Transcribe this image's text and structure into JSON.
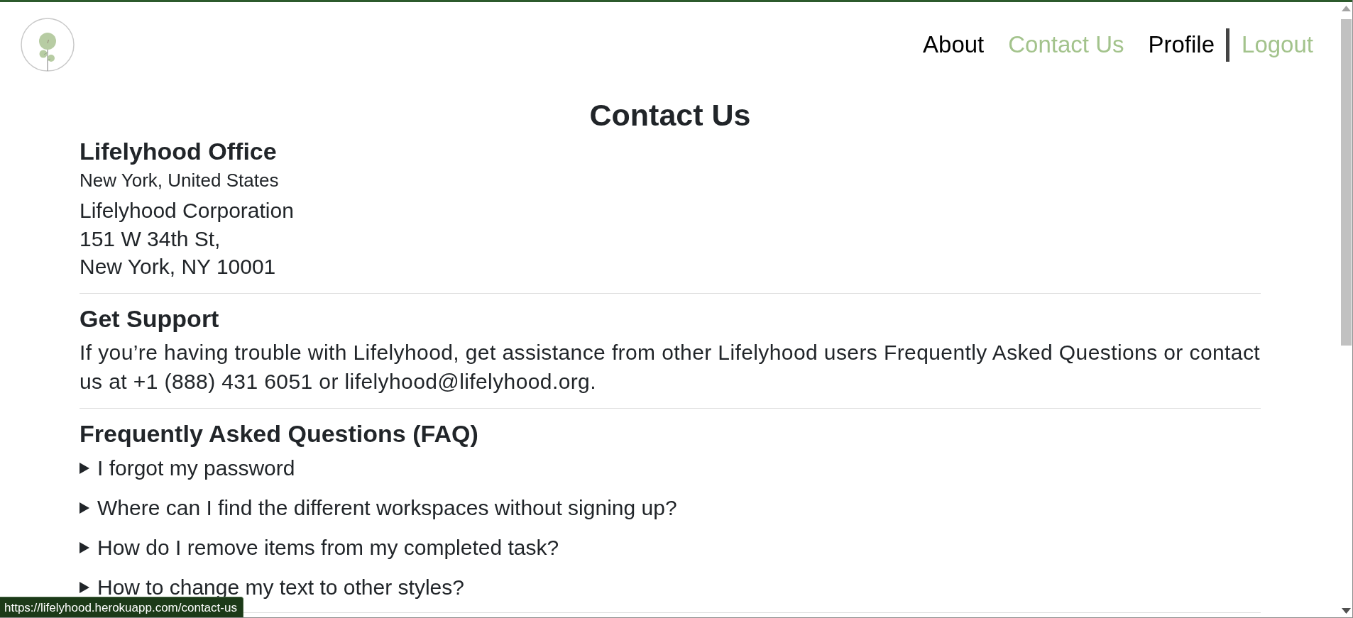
{
  "header": {
    "nav": [
      {
        "label": "About",
        "selected": false
      },
      {
        "label": "Contact Us",
        "selected": true
      },
      {
        "label": "Profile",
        "selected": false
      }
    ],
    "logout": {
      "label": "Logout"
    }
  },
  "page": {
    "title": "Contact Us"
  },
  "sections": [
    {
      "kind": "address",
      "title": "Lifelyhood Office",
      "subtitle": "New York, United States",
      "lines": [
        "Lifelyhood Corporation",
        "151 W 34th St,",
        "New York, NY 10001"
      ]
    },
    {
      "kind": "text",
      "title": "Get Support",
      "text": "If you’re having trouble with Lifelyhood, get assistance from other Lifelyhood users Frequently Asked Questions or contact us at +1 (888) 431 6051 or lifelyhood@lifelyhood.org."
    },
    {
      "kind": "faq",
      "title": "Frequently Asked Questions (FAQ)",
      "items": [
        {
          "question": "I forgot my password",
          "expanded": false
        },
        {
          "question": "Where can I find the different workspaces without signing up?",
          "expanded": false
        },
        {
          "question": "How do I remove items from my completed task?",
          "expanded": false
        },
        {
          "question": "How to change my text to other styles?",
          "expanded": false
        }
      ]
    }
  ],
  "status_bar": {
    "url": "https://lifelyhood.herokuapp.com/contact-us"
  }
}
